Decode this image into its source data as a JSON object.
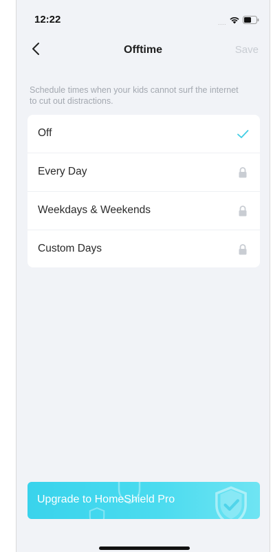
{
  "status_bar": {
    "time": "12:22",
    "signal_dots": "....",
    "icons": [
      "wifi-icon",
      "battery-icon"
    ]
  },
  "nav": {
    "back_icon": "chevron-left-icon",
    "title": "Offtime",
    "save_label": "Save"
  },
  "description": "Schedule times when your kids cannot surf the internet to cut out distractions.",
  "options": [
    {
      "label": "Off",
      "icon": "checkmark-icon",
      "selected": true
    },
    {
      "label": "Every Day",
      "icon": "lock-icon",
      "selected": false
    },
    {
      "label": "Weekdays & Weekends",
      "icon": "lock-icon",
      "selected": false
    },
    {
      "label": "Custom Days",
      "icon": "lock-icon",
      "selected": false
    }
  ],
  "upgrade": {
    "label": "Upgrade to HomeShield Pro",
    "icon": "shield-check-icon"
  },
  "colors": {
    "background": "#f1f3f7",
    "accent": "#40d6ec",
    "check": "#3fcde4",
    "lock": "#c9cdd3",
    "save_disabled": "#c8ccd2"
  }
}
